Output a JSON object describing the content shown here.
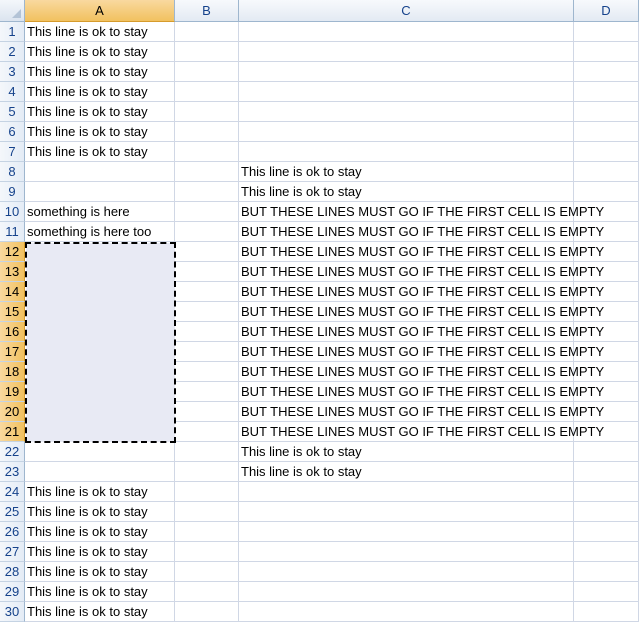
{
  "columns": [
    "A",
    "B",
    "C",
    "D"
  ],
  "selection": {
    "range": "A12:A21",
    "selected_column": "A",
    "selected_rows": [
      12,
      13,
      14,
      15,
      16,
      17,
      18,
      19,
      20,
      21
    ]
  },
  "rows": [
    {
      "num": "1",
      "a": "This line is ok to stay",
      "c": ""
    },
    {
      "num": "2",
      "a": "This line is ok to stay",
      "c": ""
    },
    {
      "num": "3",
      "a": "This line is ok to stay",
      "c": ""
    },
    {
      "num": "4",
      "a": "This line is ok to stay",
      "c": ""
    },
    {
      "num": "5",
      "a": "This line is ok to stay",
      "c": ""
    },
    {
      "num": "6",
      "a": "This line is ok to stay",
      "c": ""
    },
    {
      "num": "7",
      "a": "This line is ok to stay",
      "c": ""
    },
    {
      "num": "8",
      "a": "",
      "c": "This line is ok to stay"
    },
    {
      "num": "9",
      "a": "",
      "c": "This line is ok to stay"
    },
    {
      "num": "10",
      "a": "something is here",
      "c": "BUT THESE  LINES MUST GO IF THE FIRST CELL IS EMPTY"
    },
    {
      "num": "11",
      "a": "something is here too",
      "c": "BUT THESE  LINES MUST GO IF THE FIRST CELL IS EMPTY"
    },
    {
      "num": "12",
      "a": "",
      "c": "BUT THESE  LINES MUST GO IF THE FIRST CELL IS EMPTY"
    },
    {
      "num": "13",
      "a": "",
      "c": "BUT THESE  LINES MUST GO IF THE FIRST CELL IS EMPTY"
    },
    {
      "num": "14",
      "a": "",
      "c": "BUT THESE  LINES MUST GO IF THE FIRST CELL IS EMPTY"
    },
    {
      "num": "15",
      "a": "",
      "c": "BUT THESE  LINES MUST GO IF THE FIRST CELL IS EMPTY"
    },
    {
      "num": "16",
      "a": "",
      "c": "BUT THESE  LINES MUST GO IF THE FIRST CELL IS EMPTY"
    },
    {
      "num": "17",
      "a": "",
      "c": "BUT THESE  LINES MUST GO IF THE FIRST CELL IS EMPTY"
    },
    {
      "num": "18",
      "a": "",
      "c": "BUT THESE  LINES MUST GO IF THE FIRST CELL IS EMPTY"
    },
    {
      "num": "19",
      "a": "",
      "c": "BUT THESE  LINES MUST GO IF THE FIRST CELL IS EMPTY"
    },
    {
      "num": "20",
      "a": "",
      "c": "BUT THESE  LINES MUST GO IF THE FIRST CELL IS EMPTY"
    },
    {
      "num": "21",
      "a": "",
      "c": "BUT THESE  LINES MUST GO IF THE FIRST CELL IS EMPTY"
    },
    {
      "num": "22",
      "a": "",
      "c": "This line is ok to stay"
    },
    {
      "num": "23",
      "a": "",
      "c": "This line is ok to stay"
    },
    {
      "num": "24",
      "a": "This line is ok to stay",
      "c": ""
    },
    {
      "num": "25",
      "a": "This line is ok to stay",
      "c": ""
    },
    {
      "num": "26",
      "a": "This line is ok to stay",
      "c": ""
    },
    {
      "num": "27",
      "a": "This line is ok to stay",
      "c": ""
    },
    {
      "num": "28",
      "a": "This line is ok to stay",
      "c": ""
    },
    {
      "num": "29",
      "a": "This line is ok to stay",
      "c": ""
    },
    {
      "num": "30",
      "a": "This line is ok to stay",
      "c": ""
    }
  ]
}
